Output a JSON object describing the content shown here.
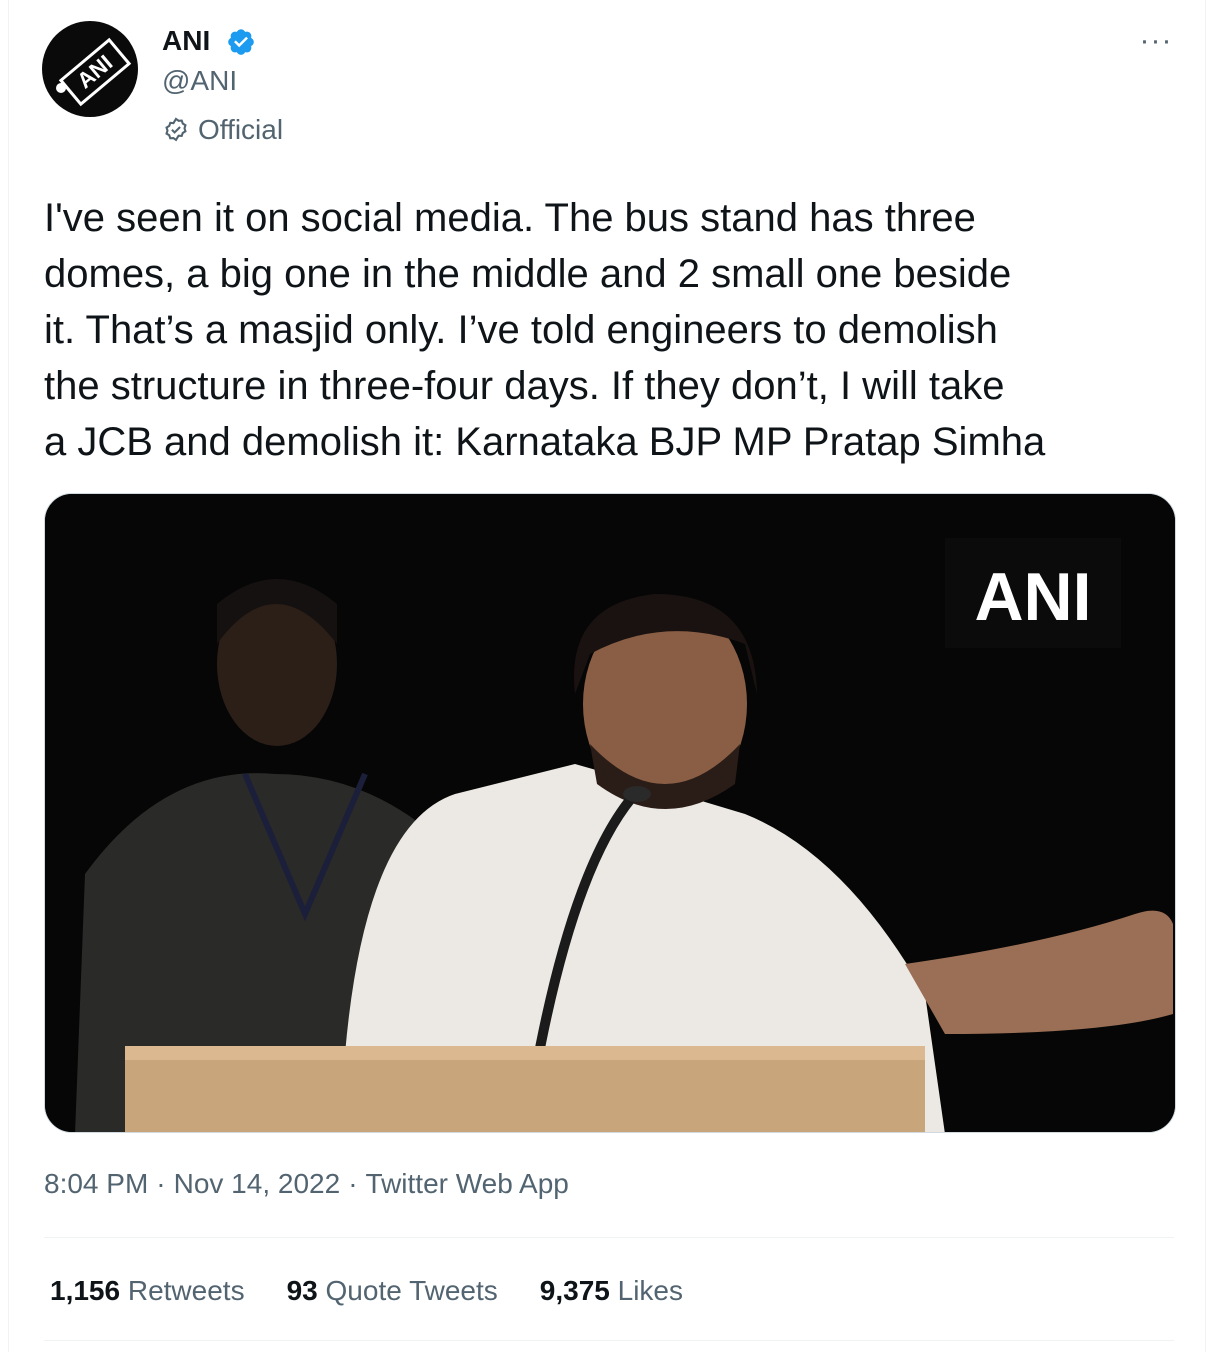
{
  "author": {
    "name": "ANI",
    "handle": "@ANI",
    "label": "Official",
    "avatar_text": "ANI"
  },
  "tweet": {
    "text": "I've seen it on social media. The bus stand has three\ndomes, a big one in the middle and 2 small one beside\nit. That’s a masjid only. I’ve told engineers to demolish\nthe structure in three-four days. If they don’t, I will take\na JCB and demolish it: Karnataka BJP MP Pratap Simha",
    "media_watermark": "ANI"
  },
  "meta": {
    "time": "8:04 PM",
    "date": "Nov 14, 2022",
    "source": "Twitter Web App"
  },
  "stats": {
    "retweets_count": "1,156",
    "retweets_label": "Retweets",
    "quotes_count": "93",
    "quotes_label": "Quote Tweets",
    "likes_count": "9,375",
    "likes_label": "Likes"
  },
  "more_label": "···",
  "colors": {
    "verified": "#1d9bf0",
    "secondary_text": "#536471",
    "border": "#eff3f4"
  },
  "icons": {
    "verified": "verified-badge-icon",
    "official": "official-check-icon",
    "more": "more-options-icon"
  }
}
